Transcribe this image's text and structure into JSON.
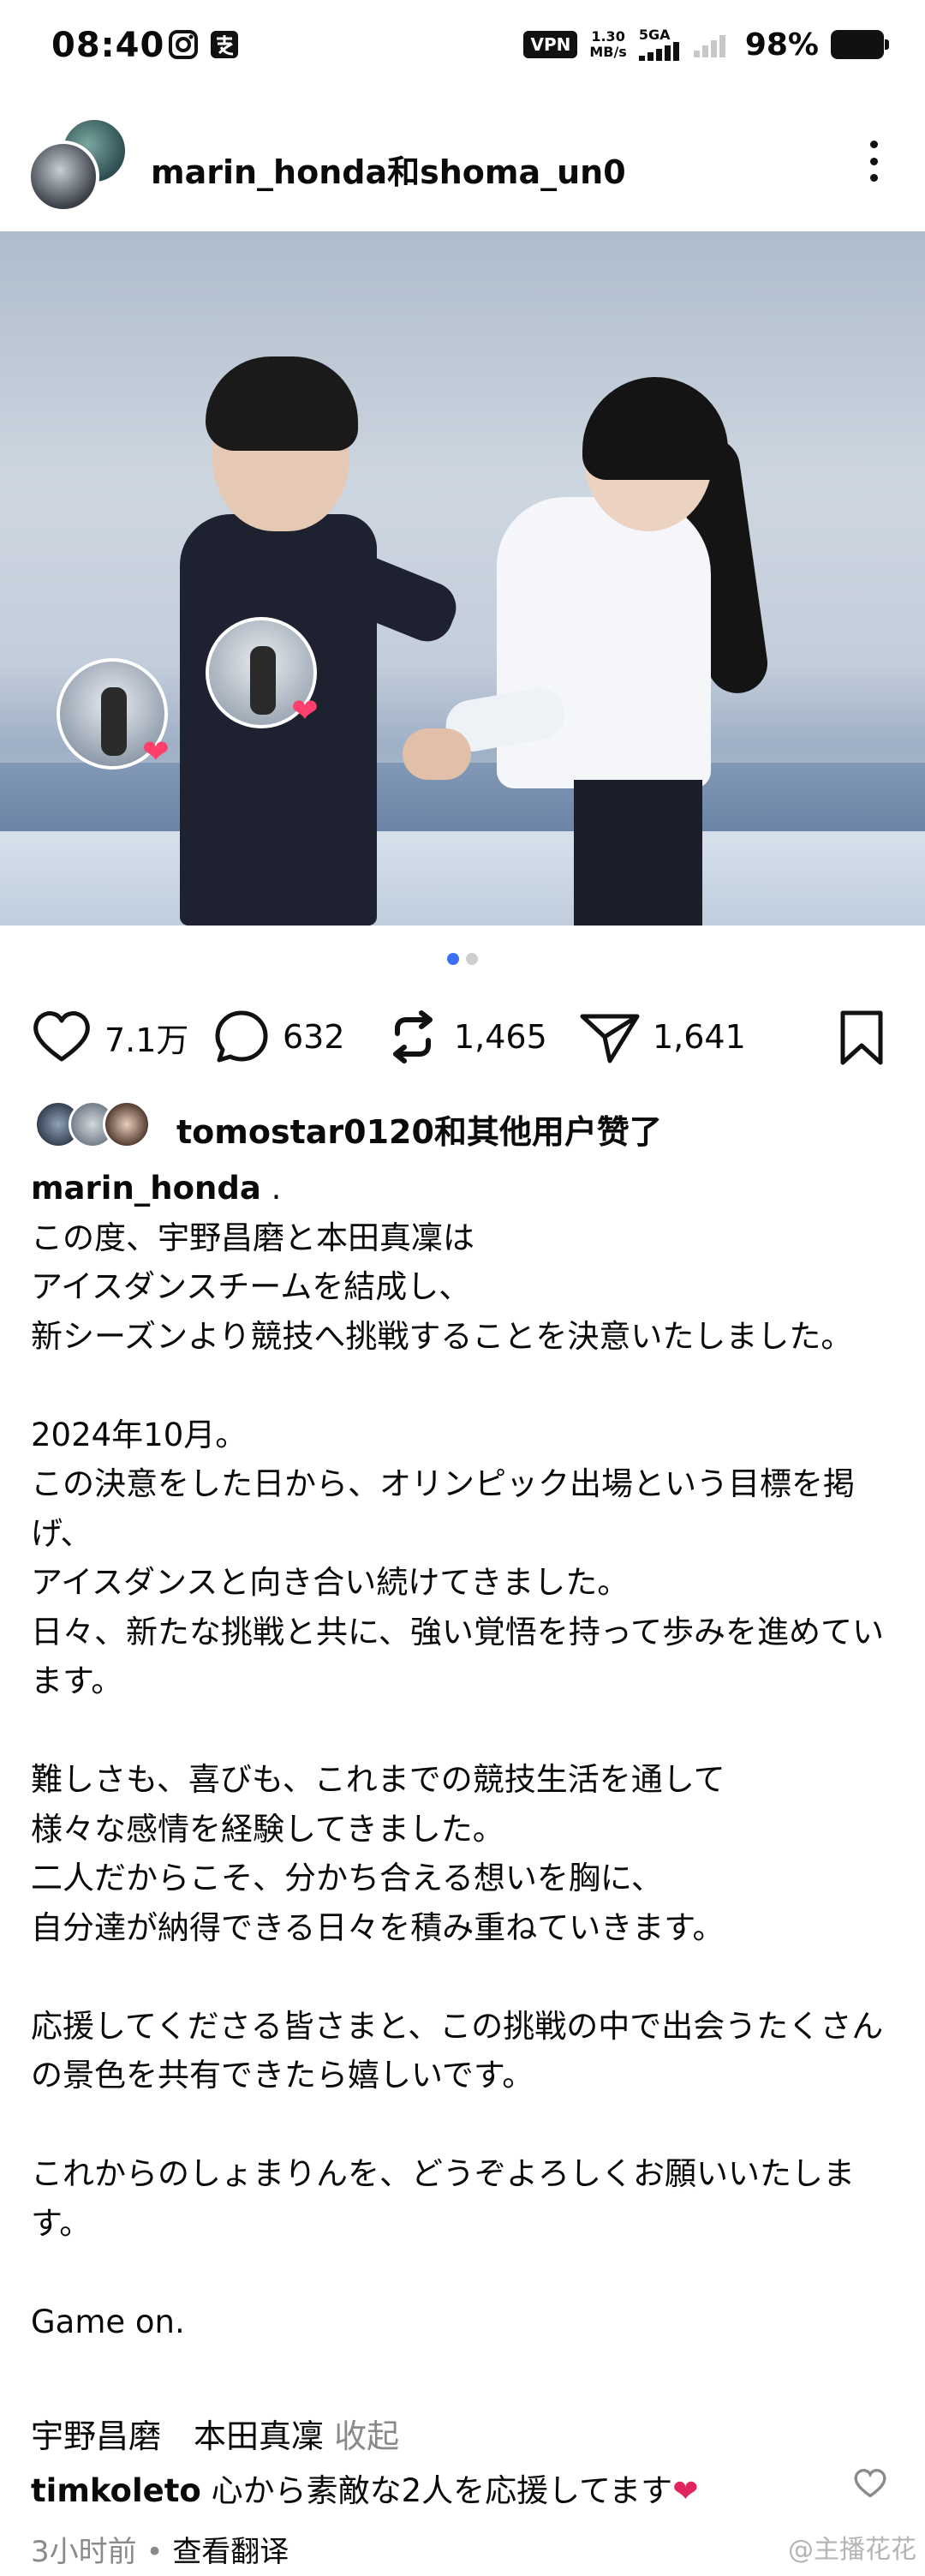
{
  "status_bar": {
    "time": "08:40",
    "vpn": "VPN",
    "speed_value": "1.30",
    "speed_unit": "MB/s",
    "network": "5GA",
    "battery": "98%"
  },
  "post": {
    "author": "marin_honda和shoma_un0",
    "carousel": {
      "count": 2,
      "active": 1
    },
    "stats": {
      "likes": "7.1万",
      "comments": "632",
      "reposts": "1,465",
      "shares": "1,641"
    },
    "liked_by": "tomostar0120和其他用户赞了",
    "caption_author": "marin_honda",
    "caption_body": " .\nこの度、宇野昌磨と本田真凜は\nアイスダンスチームを結成し、\n新シーズンより競技へ挑戦することを決意いたしました。\n\n2024年10月。\nこの決意をした日から、オリンピック出場という目標を掲げ、\nアイスダンスと向き合い続けてきました。\n日々、新たな挑戦と共に、強い覚悟を持って歩みを進めています。\n\n難しさも、喜びも、これまでの競技生活を通して\n様々な感情を経験してきました。\n二人だからこそ、分かち合える想いを胸に、\n自分達が納得できる日々を積み重ねていきます。\n\n応援してくださる皆さまと、この挑戦の中で出会うたくさんの景色を共有できたら嬉しいです。\n\nこれからのしょまりんを、どうぞよろしくお願いいたします。\n\nGame on.",
    "caption_signature": "宇野昌磨　本田真凜 ",
    "collapse_label": "收起"
  },
  "comment": {
    "user": "timkoleto",
    "text": " 心から素敵な2人を応援してます",
    "time": "3小时前",
    "separator": " • ",
    "translate": "查看翻译"
  },
  "watermark": "@主播花花",
  "icons": {
    "like": "heart-outline-icon",
    "comment": "speech-bubble-icon",
    "repost": "repost-arrows-icon",
    "share": "send-icon",
    "save": "bookmark-icon",
    "more": "more-vertical-icon"
  },
  "colors": {
    "accent": "#3b6ff5",
    "heart": "#ff3f6c",
    "muted": "#8a8a8a"
  }
}
